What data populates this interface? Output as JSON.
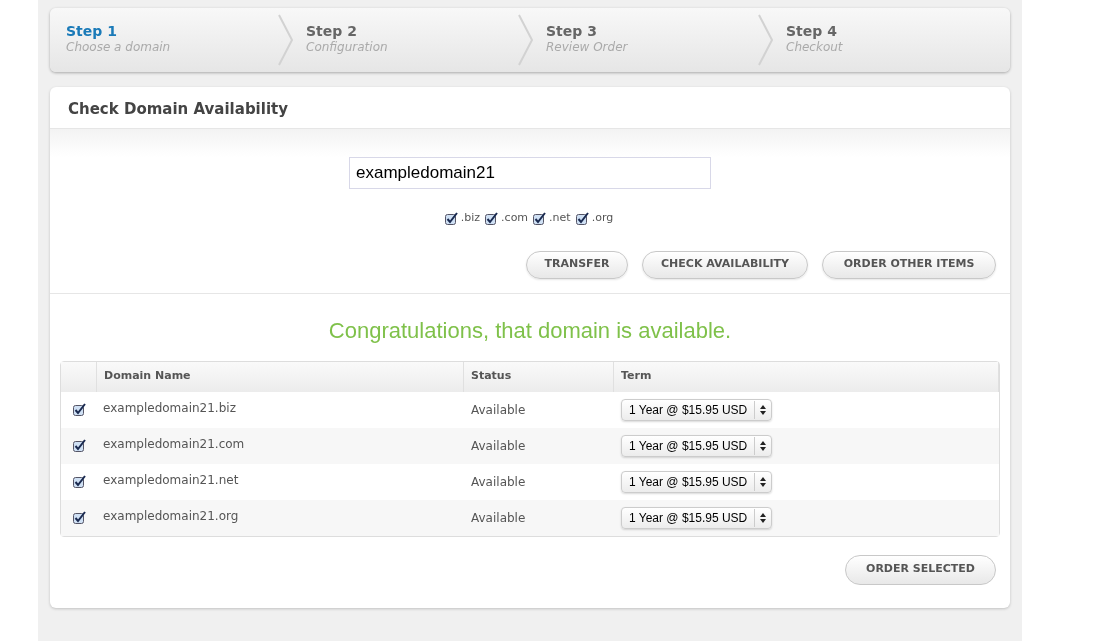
{
  "steps": [
    {
      "title": "Step 1",
      "subtitle": "Choose a domain",
      "selected": true
    },
    {
      "title": "Step 2",
      "subtitle": "Configuration",
      "selected": false
    },
    {
      "title": "Step 3",
      "subtitle": "Review Order",
      "selected": false
    },
    {
      "title": "Step 4",
      "subtitle": "Checkout",
      "selected": false
    }
  ],
  "panel": {
    "title": "Check Domain Availability"
  },
  "search": {
    "value": "exampledomain21"
  },
  "tlds": [
    {
      "label": ".biz",
      "checked": true
    },
    {
      "label": ".com",
      "checked": true
    },
    {
      "label": ".net",
      "checked": true
    },
    {
      "label": ".org",
      "checked": true
    }
  ],
  "buttons": [
    "TRANSFER",
    "CHECK AVAILABILITY",
    "ORDER OTHER ITEMS"
  ],
  "message": "Congratulations, that domain is available.",
  "table": {
    "columns": [
      "Domain Name",
      "Status",
      "Term"
    ],
    "rows": [
      {
        "checked": true,
        "domain": "exampledomain21.biz",
        "status": "Available",
        "term": "1 Year @ $15.95 USD"
      },
      {
        "checked": true,
        "domain": "exampledomain21.com",
        "status": "Available",
        "term": "1 Year @ $15.95 USD"
      },
      {
        "checked": true,
        "domain": "exampledomain21.net",
        "status": "Available",
        "term": "1 Year @ $15.95 USD"
      },
      {
        "checked": true,
        "domain": "exampledomain21.org",
        "status": "Available",
        "term": "1 Year @ $15.95 USD"
      }
    ]
  },
  "order_button": "ORDER SELECTED"
}
